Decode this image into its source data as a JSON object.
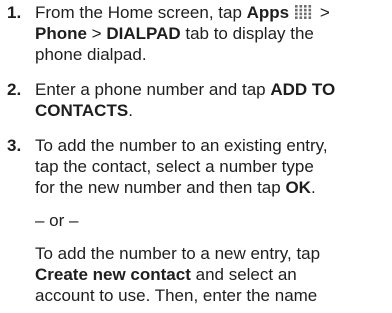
{
  "steps": [
    {
      "number": "1.",
      "l1_pre": "From the Home screen, tap ",
      "l1_b": "Apps",
      "l1_post": " >",
      "l2_b1": "Phone",
      "l2_sep": " > ",
      "l2_b2": "DIALPAD",
      "l2_post": " tab to display the",
      "l3": "phone dialpad."
    },
    {
      "number": "2.",
      "l1_pre": "Enter a phone number and tap ",
      "l1_b": "ADD TO",
      "l2_b": "CONTACTS",
      "l2_post": "."
    },
    {
      "number": "3.",
      "l1": "To add the number to an existing entry,",
      "l2": "tap the contact, select a number type",
      "l3_pre": "for the new number and then tap ",
      "l3_b": "OK",
      "l3_post": ".",
      "or": "– or –",
      "l5": "To add the number to a new entry, tap",
      "l6_b": "Create new contact",
      "l6_post": " and select an",
      "l7": "account to use. Then, enter the name"
    }
  ],
  "icons": {
    "apps": "apps-grid-icon"
  },
  "colors": {
    "text": "#1e1e1e",
    "icon": "#6e6e6e"
  }
}
